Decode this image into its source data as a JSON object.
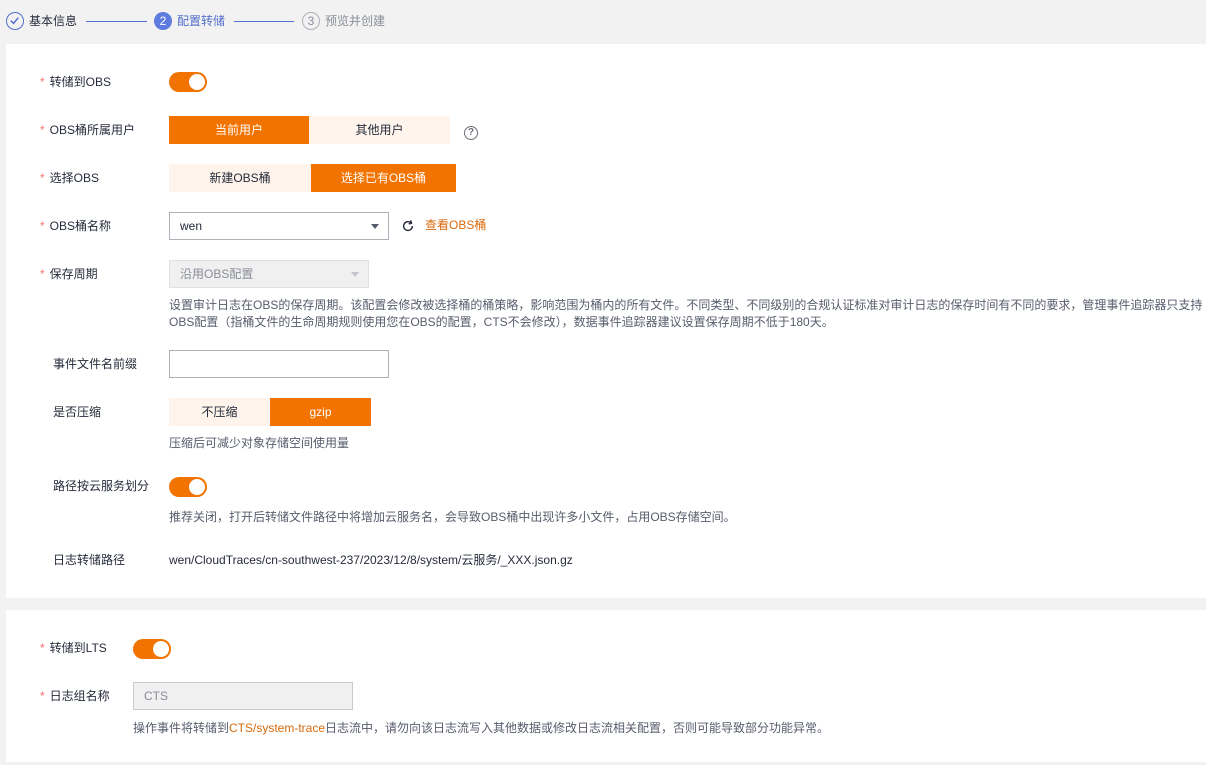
{
  "steps": [
    {
      "number": "",
      "label": "基本信息",
      "state": "done"
    },
    {
      "number": "2",
      "label": "配置转储",
      "state": "active"
    },
    {
      "number": "3",
      "label": "预览并创建",
      "state": "todo"
    }
  ],
  "obs": {
    "transfer_label": "转储到OBS",
    "transfer_enabled": true,
    "owner_label": "OBS桶所属用户",
    "owner_options": [
      "当前用户",
      "其他用户"
    ],
    "owner_selected": "当前用户",
    "select_label": "选择OBS",
    "select_options": [
      "新建OBS桶",
      "选择已有OBS桶"
    ],
    "select_selected": "选择已有OBS桶",
    "bucket_label": "OBS桶名称",
    "bucket_value": "wen",
    "view_bucket_link": "查看OBS桶",
    "retention_label": "保存周期",
    "retention_value": "沿用OBS配置",
    "retention_hint_line1": "设置审计日志在OBS的保存周期。该配置会修改被选择桶的桶策略，影响范围为桶内的所有文件。不同类型、不同级别的合规认证标准对审计日志的保存时间有不同的要求，管理事件追踪器只支持",
    "retention_hint_line2": "OBS配置（指桶文件的生命周期规则使用您在OBS的配置，CTS不会修改），数据事件追踪器建议设置保存周期不低于180天。",
    "prefix_label": "事件文件名前缀",
    "prefix_value": "",
    "compress_label": "是否压缩",
    "compress_options": [
      "不压缩",
      "gzip"
    ],
    "compress_selected": "gzip",
    "compress_hint": "压缩后可减少对象存储空间使用量",
    "path_split_label": "路径按云服务划分",
    "path_split_enabled": true,
    "path_split_hint": "推荐关闭，打开后转储文件路径中将增加云服务名，会导致OBS桶中出现许多小文件，占用OBS存储空间。",
    "log_path_label": "日志转储路径",
    "log_path_value": "wen/CloudTraces/cn-southwest-237/2023/12/8/system/云服务/_XXX.json.gz"
  },
  "lts": {
    "transfer_label": "转储到LTS",
    "transfer_enabled": true,
    "group_label": "日志组名称",
    "group_value": "CTS",
    "hint_prefix": "操作事件将转储到",
    "hint_highlight": "CTS/system-trace",
    "hint_suffix": "日志流中，请勿向该日志流写入其他数据或修改日志流相关配置，否则可能导致部分功能异常。"
  },
  "colors": {
    "accent": "#f27300",
    "segment_off": "#fef4ec",
    "link": "#d9690c",
    "step_active": "#5e7ce0",
    "required": "#f66f6a"
  },
  "icons": {
    "step_done": "check-circle-icon",
    "help": "question-circle-icon",
    "refresh": "refresh-icon",
    "dropdown": "caret-down-icon"
  }
}
